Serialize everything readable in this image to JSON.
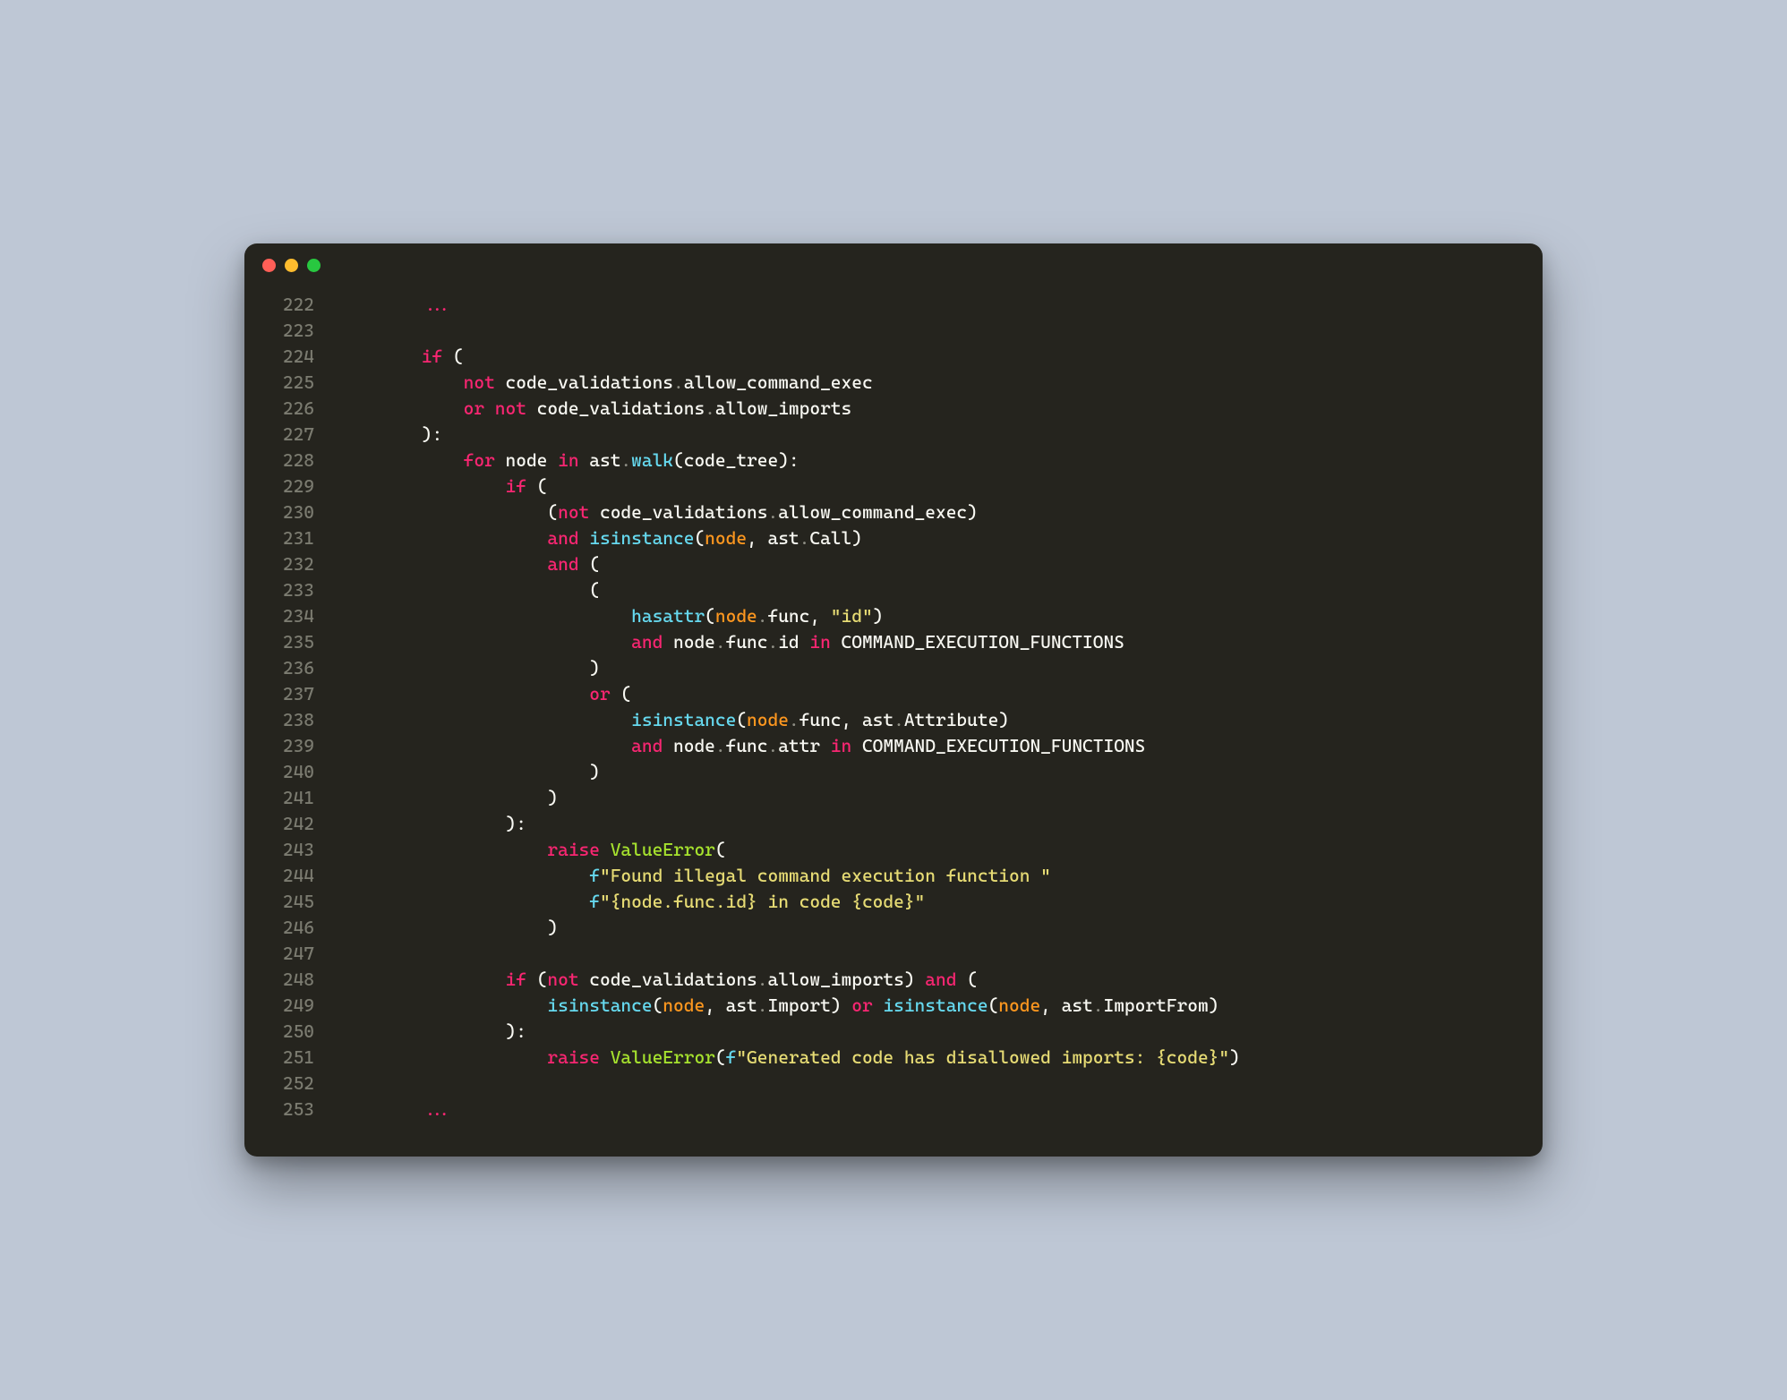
{
  "colors": {
    "background_page": "#bec7d5",
    "background_window": "#25241e",
    "traffic_red": "#ff5f57",
    "traffic_yellow": "#febc2e",
    "traffic_green": "#28c840",
    "line_number": "#7b7b70",
    "token_default": "#f8f8f2",
    "token_keyword": "#f92672",
    "token_builtin": "#66d9ef",
    "token_param": "#fd971f",
    "token_string": "#e6db74",
    "token_class": "#a6e22e",
    "token_dim": "#8f8f85"
  },
  "lines": [
    {
      "n": 222,
      "tokens": [
        {
          "cls": "default",
          "t": "        "
        },
        {
          "cls": "keyword",
          "t": "..."
        }
      ]
    },
    {
      "n": 223,
      "tokens": []
    },
    {
      "n": 224,
      "tokens": [
        {
          "cls": "default",
          "t": "        "
        },
        {
          "cls": "keyword",
          "t": "if"
        },
        {
          "cls": "default",
          "t": " ("
        }
      ]
    },
    {
      "n": 225,
      "tokens": [
        {
          "cls": "default",
          "t": "            "
        },
        {
          "cls": "keyword",
          "t": "not"
        },
        {
          "cls": "default",
          "t": " code_validations"
        },
        {
          "cls": "dimpunct",
          "t": "."
        },
        {
          "cls": "default",
          "t": "allow_command_exec"
        }
      ]
    },
    {
      "n": 226,
      "tokens": [
        {
          "cls": "default",
          "t": "            "
        },
        {
          "cls": "keyword",
          "t": "or"
        },
        {
          "cls": "default",
          "t": " "
        },
        {
          "cls": "keyword",
          "t": "not"
        },
        {
          "cls": "default",
          "t": " code_validations"
        },
        {
          "cls": "dimpunct",
          "t": "."
        },
        {
          "cls": "default",
          "t": "allow_imports"
        }
      ]
    },
    {
      "n": 227,
      "tokens": [
        {
          "cls": "default",
          "t": "        ):"
        }
      ]
    },
    {
      "n": 228,
      "tokens": [
        {
          "cls": "default",
          "t": "            "
        },
        {
          "cls": "keyword",
          "t": "for"
        },
        {
          "cls": "default",
          "t": " node "
        },
        {
          "cls": "keyword",
          "t": "in"
        },
        {
          "cls": "default",
          "t": " ast"
        },
        {
          "cls": "dimpunct",
          "t": "."
        },
        {
          "cls": "builtin",
          "t": "walk"
        },
        {
          "cls": "default",
          "t": "(code_tree):"
        }
      ]
    },
    {
      "n": 229,
      "tokens": [
        {
          "cls": "default",
          "t": "                "
        },
        {
          "cls": "keyword",
          "t": "if"
        },
        {
          "cls": "default",
          "t": " ("
        }
      ]
    },
    {
      "n": 230,
      "tokens": [
        {
          "cls": "default",
          "t": "                    ("
        },
        {
          "cls": "keyword",
          "t": "not"
        },
        {
          "cls": "default",
          "t": " code_validations"
        },
        {
          "cls": "dimpunct",
          "t": "."
        },
        {
          "cls": "default",
          "t": "allow_command_exec)"
        }
      ]
    },
    {
      "n": 231,
      "tokens": [
        {
          "cls": "default",
          "t": "                    "
        },
        {
          "cls": "keyword",
          "t": "and"
        },
        {
          "cls": "default",
          "t": " "
        },
        {
          "cls": "builtin",
          "t": "isinstance"
        },
        {
          "cls": "default",
          "t": "("
        },
        {
          "cls": "param",
          "t": "node"
        },
        {
          "cls": "default",
          "t": ", ast"
        },
        {
          "cls": "dimpunct",
          "t": "."
        },
        {
          "cls": "default",
          "t": "Call)"
        }
      ]
    },
    {
      "n": 232,
      "tokens": [
        {
          "cls": "default",
          "t": "                    "
        },
        {
          "cls": "keyword",
          "t": "and"
        },
        {
          "cls": "default",
          "t": " ("
        }
      ]
    },
    {
      "n": 233,
      "tokens": [
        {
          "cls": "default",
          "t": "                        ("
        }
      ]
    },
    {
      "n": 234,
      "tokens": [
        {
          "cls": "default",
          "t": "                            "
        },
        {
          "cls": "builtin",
          "t": "hasattr"
        },
        {
          "cls": "default",
          "t": "("
        },
        {
          "cls": "param",
          "t": "node"
        },
        {
          "cls": "dimpunct",
          "t": "."
        },
        {
          "cls": "default",
          "t": "func, "
        },
        {
          "cls": "string",
          "t": "\"id\""
        },
        {
          "cls": "default",
          "t": ")"
        }
      ]
    },
    {
      "n": 235,
      "tokens": [
        {
          "cls": "default",
          "t": "                            "
        },
        {
          "cls": "keyword",
          "t": "and"
        },
        {
          "cls": "default",
          "t": " node"
        },
        {
          "cls": "dimpunct",
          "t": "."
        },
        {
          "cls": "default",
          "t": "func"
        },
        {
          "cls": "dimpunct",
          "t": "."
        },
        {
          "cls": "default",
          "t": "id "
        },
        {
          "cls": "keyword",
          "t": "in"
        },
        {
          "cls": "default",
          "t": " COMMAND_EXECUTION_FUNCTIONS"
        }
      ]
    },
    {
      "n": 236,
      "tokens": [
        {
          "cls": "default",
          "t": "                        )"
        }
      ]
    },
    {
      "n": 237,
      "tokens": [
        {
          "cls": "default",
          "t": "                        "
        },
        {
          "cls": "keyword",
          "t": "or"
        },
        {
          "cls": "default",
          "t": " ("
        }
      ]
    },
    {
      "n": 238,
      "tokens": [
        {
          "cls": "default",
          "t": "                            "
        },
        {
          "cls": "builtin",
          "t": "isinstance"
        },
        {
          "cls": "default",
          "t": "("
        },
        {
          "cls": "param",
          "t": "node"
        },
        {
          "cls": "dimpunct",
          "t": "."
        },
        {
          "cls": "default",
          "t": "func, ast"
        },
        {
          "cls": "dimpunct",
          "t": "."
        },
        {
          "cls": "default",
          "t": "Attribute)"
        }
      ]
    },
    {
      "n": 239,
      "tokens": [
        {
          "cls": "default",
          "t": "                            "
        },
        {
          "cls": "keyword",
          "t": "and"
        },
        {
          "cls": "default",
          "t": " node"
        },
        {
          "cls": "dimpunct",
          "t": "."
        },
        {
          "cls": "default",
          "t": "func"
        },
        {
          "cls": "dimpunct",
          "t": "."
        },
        {
          "cls": "default",
          "t": "attr "
        },
        {
          "cls": "keyword",
          "t": "in"
        },
        {
          "cls": "default",
          "t": " COMMAND_EXECUTION_FUNCTIONS"
        }
      ]
    },
    {
      "n": 240,
      "tokens": [
        {
          "cls": "default",
          "t": "                        )"
        }
      ]
    },
    {
      "n": 241,
      "tokens": [
        {
          "cls": "default",
          "t": "                    )"
        }
      ]
    },
    {
      "n": 242,
      "tokens": [
        {
          "cls": "default",
          "t": "                ):"
        }
      ]
    },
    {
      "n": 243,
      "tokens": [
        {
          "cls": "default",
          "t": "                    "
        },
        {
          "cls": "keyword",
          "t": "raise"
        },
        {
          "cls": "default",
          "t": " "
        },
        {
          "cls": "class",
          "t": "ValueError"
        },
        {
          "cls": "default",
          "t": "("
        }
      ]
    },
    {
      "n": 244,
      "tokens": [
        {
          "cls": "default",
          "t": "                        "
        },
        {
          "cls": "builtin",
          "t": "f"
        },
        {
          "cls": "string",
          "t": "\"Found illegal command execution function \""
        }
      ]
    },
    {
      "n": 245,
      "tokens": [
        {
          "cls": "default",
          "t": "                        "
        },
        {
          "cls": "builtin",
          "t": "f"
        },
        {
          "cls": "string",
          "t": "\"{node.func.id} in code {code}\""
        }
      ]
    },
    {
      "n": 246,
      "tokens": [
        {
          "cls": "default",
          "t": "                    )"
        }
      ]
    },
    {
      "n": 247,
      "tokens": []
    },
    {
      "n": 248,
      "tokens": [
        {
          "cls": "default",
          "t": "                "
        },
        {
          "cls": "keyword",
          "t": "if"
        },
        {
          "cls": "default",
          "t": " ("
        },
        {
          "cls": "keyword",
          "t": "not"
        },
        {
          "cls": "default",
          "t": " code_validations"
        },
        {
          "cls": "dimpunct",
          "t": "."
        },
        {
          "cls": "default",
          "t": "allow_imports) "
        },
        {
          "cls": "keyword",
          "t": "and"
        },
        {
          "cls": "default",
          "t": " ("
        }
      ]
    },
    {
      "n": 249,
      "tokens": [
        {
          "cls": "default",
          "t": "                    "
        },
        {
          "cls": "builtin",
          "t": "isinstance"
        },
        {
          "cls": "default",
          "t": "("
        },
        {
          "cls": "param",
          "t": "node"
        },
        {
          "cls": "default",
          "t": ", ast"
        },
        {
          "cls": "dimpunct",
          "t": "."
        },
        {
          "cls": "default",
          "t": "Import) "
        },
        {
          "cls": "keyword",
          "t": "or"
        },
        {
          "cls": "default",
          "t": " "
        },
        {
          "cls": "builtin",
          "t": "isinstance"
        },
        {
          "cls": "default",
          "t": "("
        },
        {
          "cls": "param",
          "t": "node"
        },
        {
          "cls": "default",
          "t": ", ast"
        },
        {
          "cls": "dimpunct",
          "t": "."
        },
        {
          "cls": "default",
          "t": "ImportFrom)"
        }
      ]
    },
    {
      "n": 250,
      "tokens": [
        {
          "cls": "default",
          "t": "                ):"
        }
      ]
    },
    {
      "n": 251,
      "tokens": [
        {
          "cls": "default",
          "t": "                    "
        },
        {
          "cls": "keyword",
          "t": "raise"
        },
        {
          "cls": "default",
          "t": " "
        },
        {
          "cls": "class",
          "t": "ValueError"
        },
        {
          "cls": "default",
          "t": "("
        },
        {
          "cls": "builtin",
          "t": "f"
        },
        {
          "cls": "string",
          "t": "\"Generated code has disallowed imports: {code}\""
        },
        {
          "cls": "default",
          "t": ")"
        }
      ]
    },
    {
      "n": 252,
      "tokens": []
    },
    {
      "n": 253,
      "tokens": [
        {
          "cls": "default",
          "t": "        "
        },
        {
          "cls": "keyword",
          "t": "..."
        }
      ]
    }
  ]
}
